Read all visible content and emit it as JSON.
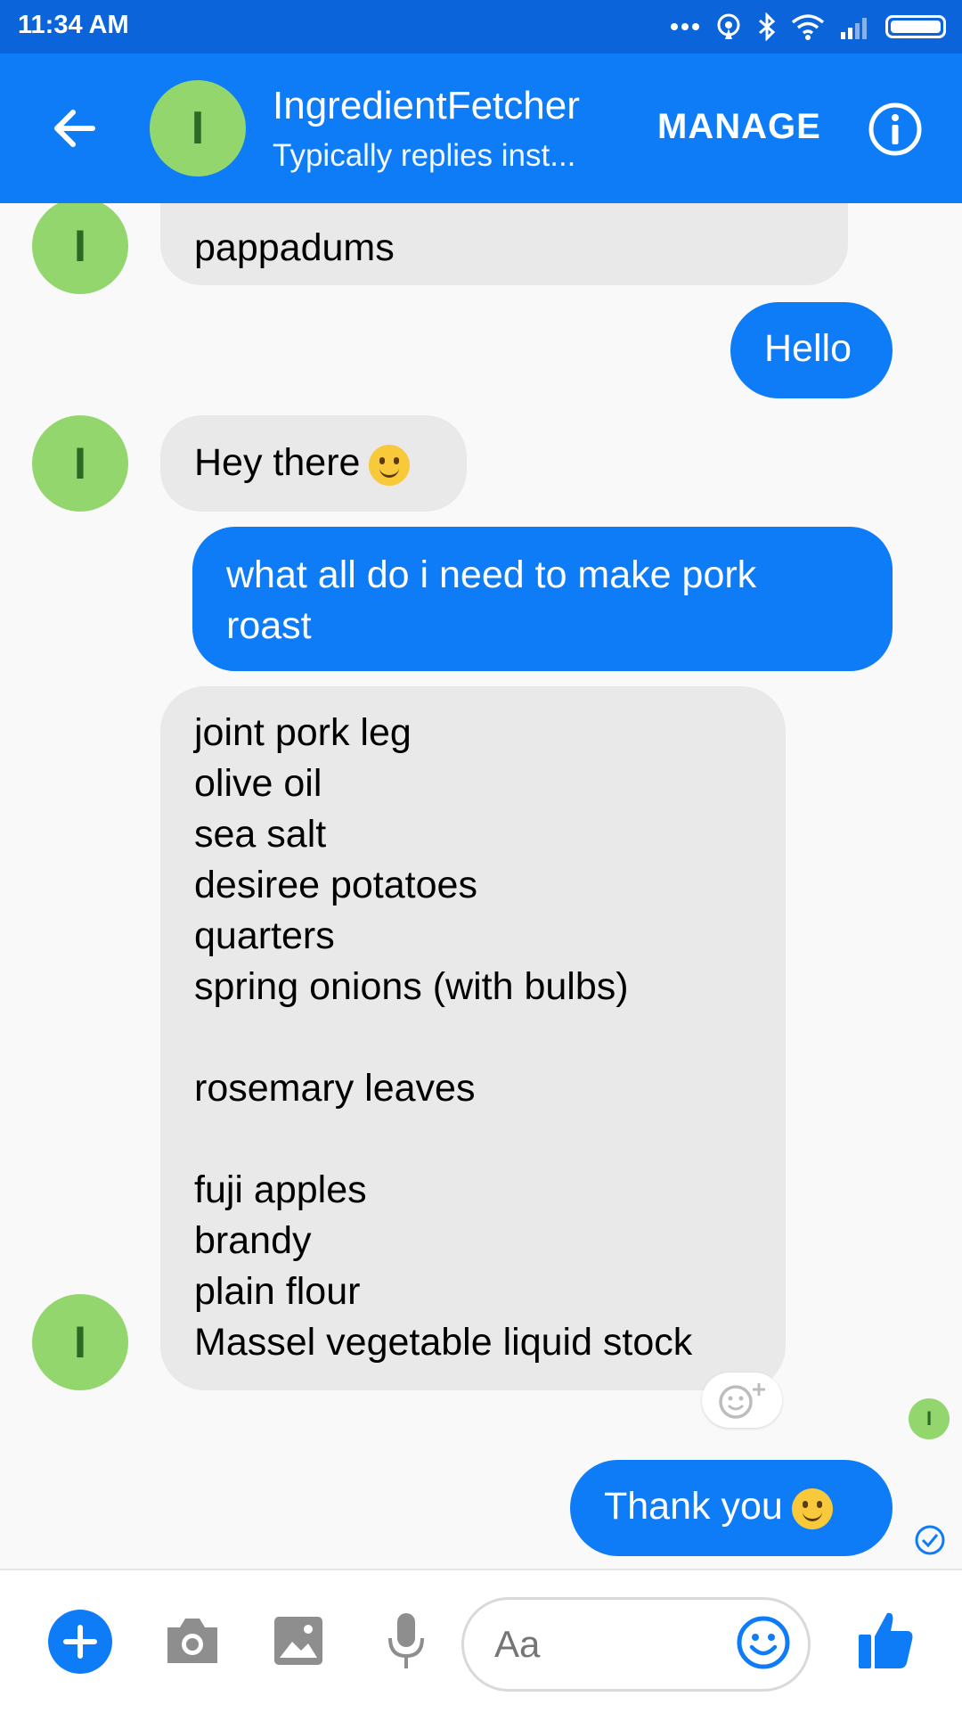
{
  "status_bar": {
    "time": "11:34 AM"
  },
  "header": {
    "avatar_letter": "I",
    "name": "IngredientFetcher",
    "subtitle": "Typically replies inst...",
    "manage_label": "MANAGE"
  },
  "messages": [
    {
      "from": "bot",
      "text": "pappadums"
    },
    {
      "from": "me",
      "text": "Hello"
    },
    {
      "from": "bot",
      "text": "Hey there",
      "emoji": "slightly-smiling-face"
    },
    {
      "from": "me",
      "lines": [
        "what all do i need to make pork",
        "roast"
      ]
    },
    {
      "from": "bot",
      "lines": [
        "joint pork leg",
        "olive oil",
        "sea salt",
        "desiree potatoes",
        "quarters",
        "spring onions (with bulbs)",
        "",
        "rosemary leaves",
        "",
        "fuji apples",
        "brandy",
        "plain flour",
        "Massel vegetable liquid stock"
      ]
    },
    {
      "from": "me",
      "text": "Thank you",
      "emoji": "slightly-smiling-face"
    }
  ],
  "composer": {
    "placeholder": "Aa"
  },
  "colors": {
    "brand": "#0e7cf6",
    "status_bar": "#0b64d9",
    "avatar": "#94d66e",
    "bubble_in": "#e9e9e9"
  }
}
